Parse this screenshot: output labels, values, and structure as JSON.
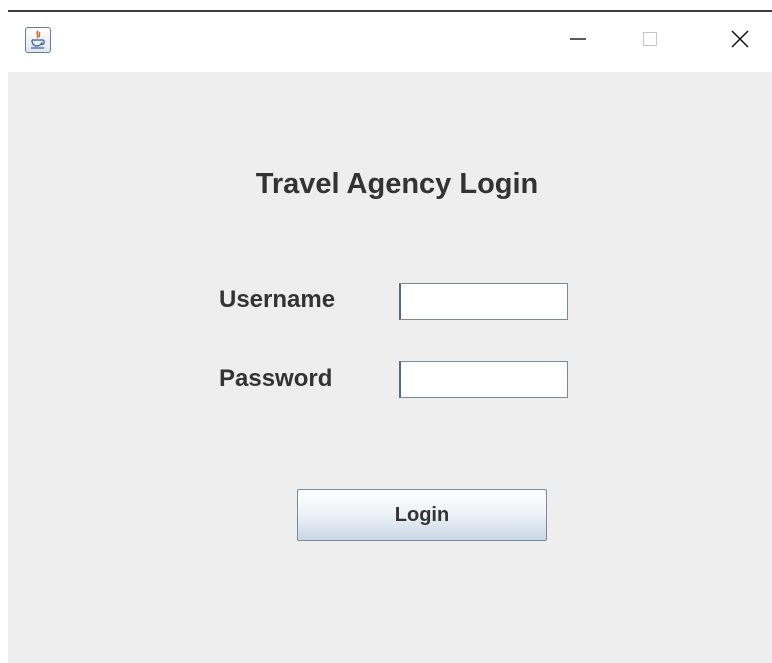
{
  "window": {
    "icon": "java-cup-icon",
    "controls": {
      "minimize": "minimize-icon",
      "maximize": "maximize-icon",
      "close": "close-icon"
    }
  },
  "form": {
    "title": "Travel Agency Login",
    "username_label": "Username",
    "username_value": "",
    "password_label": "Password",
    "password_value": "",
    "login_label": "Login"
  },
  "colors": {
    "panel_background": "#eeeeee",
    "text": "#333333",
    "field_border": "#7a8a99"
  }
}
